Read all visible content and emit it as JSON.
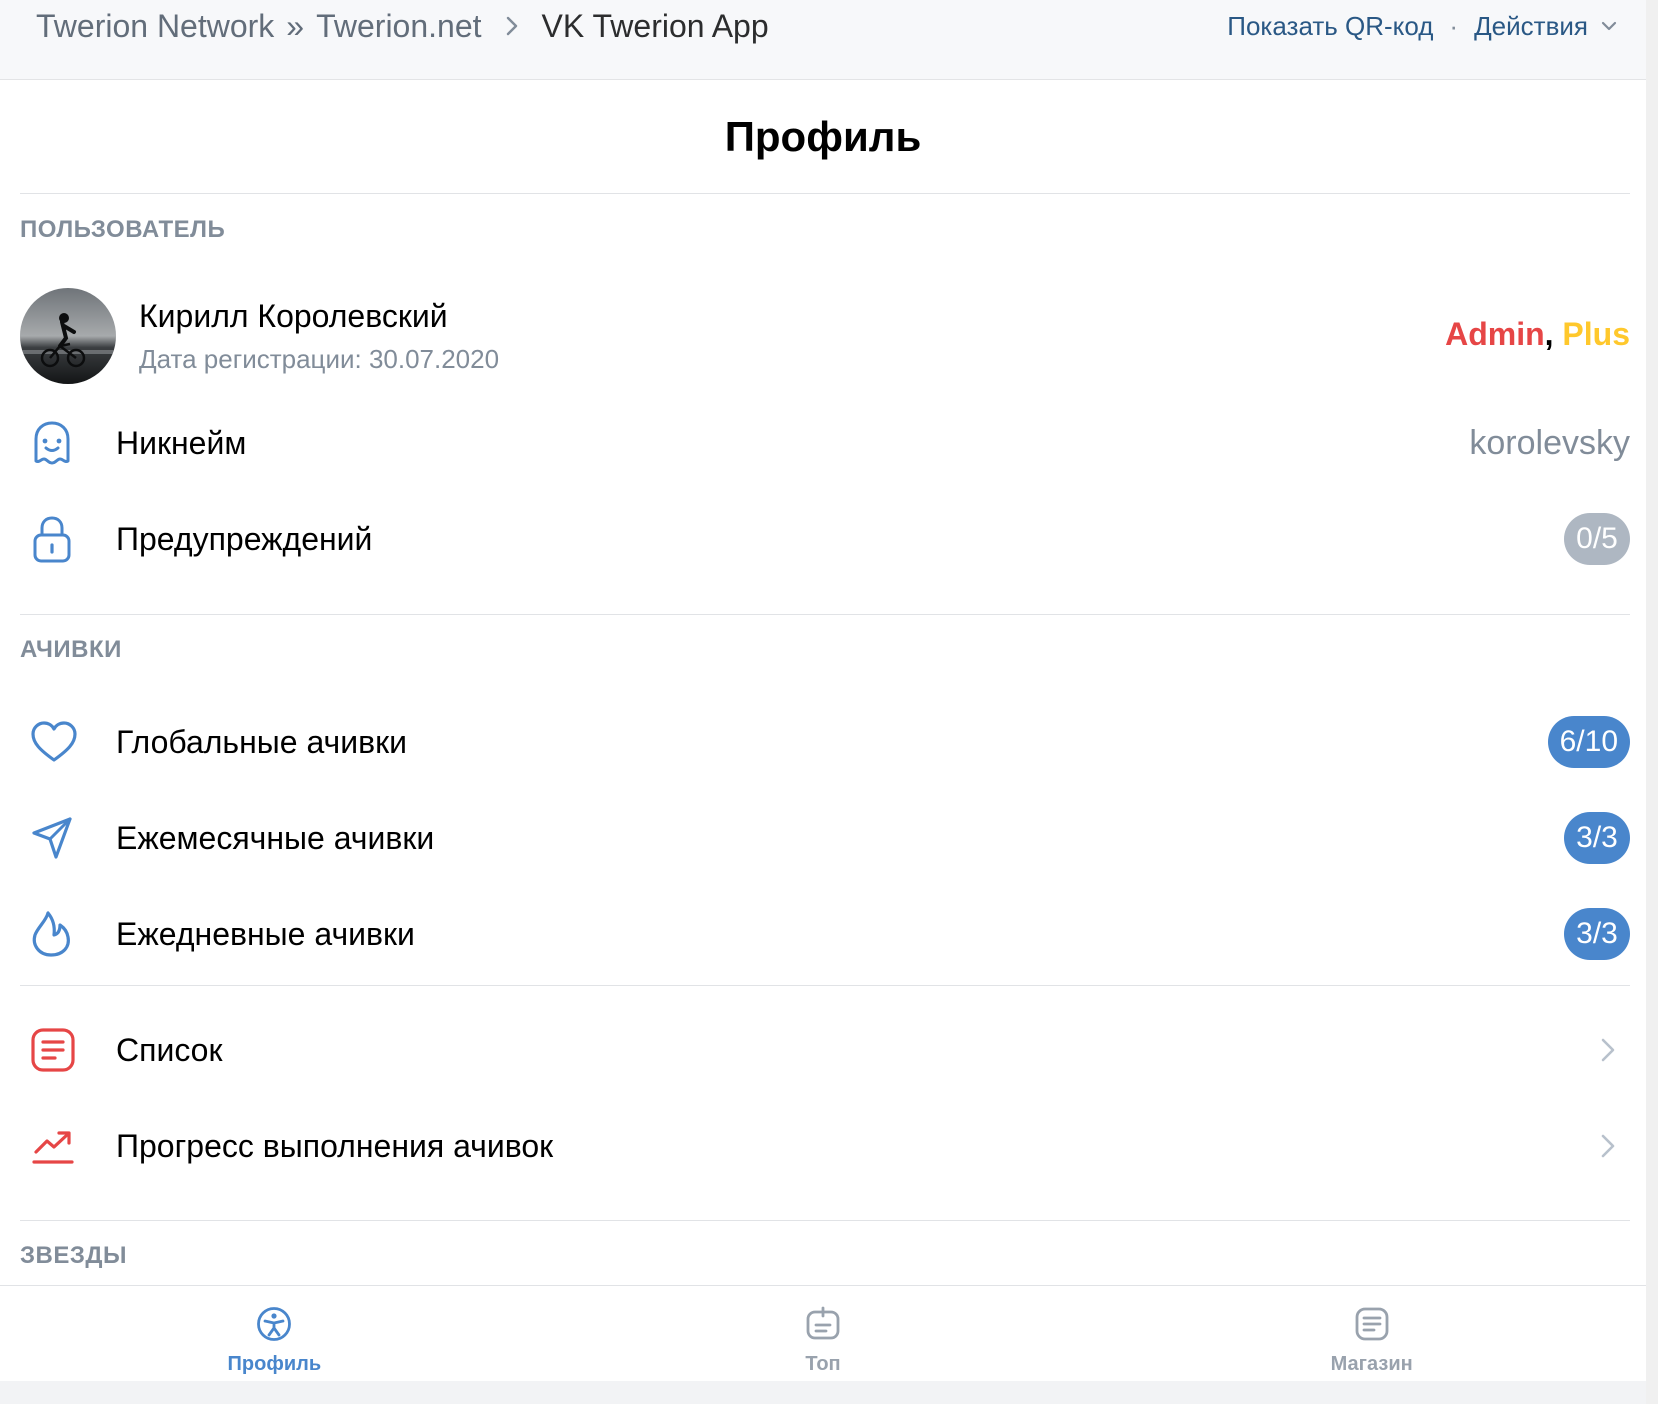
{
  "header": {
    "network_label": "Twerion Network",
    "breadcrumb_sep": "»",
    "site_label": "Twerion.net",
    "app_title": "VK Twerion App",
    "qr_label": "Показать QR-код",
    "dot": "·",
    "actions_label": "Действия"
  },
  "panel": {
    "title": "Профиль"
  },
  "sections": {
    "user": "ПОЛЬЗОВАТЕЛЬ",
    "achievements": "АЧИВКИ",
    "stars": "ЗВЕЗДЫ"
  },
  "user": {
    "name": "Кирилл Королевский",
    "registration": "Дата регистрации: 30.07.2020",
    "role_admin": "Admin",
    "role_sep": ",",
    "role_plus": "Plus",
    "admin_color": "#e64646",
    "plus_color": "#ffc82c"
  },
  "info": {
    "nickname_label": "Никнейм",
    "nickname_value": "korolevsky",
    "warnings_label": "Предупреждений",
    "warnings_value": "0/5"
  },
  "achievements": {
    "global_label": "Глобальные ачивки",
    "global_value": "6/10",
    "monthly_label": "Ежемесячные ачивки",
    "monthly_value": "3/3",
    "daily_label": "Ежедневные ачивки",
    "daily_value": "3/3"
  },
  "links": {
    "list_label": "Список",
    "progress_label": "Прогресс выполнения ачивок"
  },
  "tabbar": {
    "profile": "Профиль",
    "top": "Топ",
    "shop": "Магазин",
    "active": "profile"
  },
  "colors": {
    "accent": "#4986cc",
    "link": "#2a5885",
    "red_icon": "#e64646",
    "secondary_text": "#818c99"
  },
  "icons": {
    "nickname": "ghost-icon",
    "warnings": "lock-icon",
    "global": "heart-icon",
    "monthly": "send-icon",
    "daily": "fire-icon",
    "list": "article-icon",
    "progress": "trending-up-icon",
    "tab_profile": "accessibility-icon",
    "tab_top": "poll-icon",
    "tab_shop": "article-icon"
  }
}
